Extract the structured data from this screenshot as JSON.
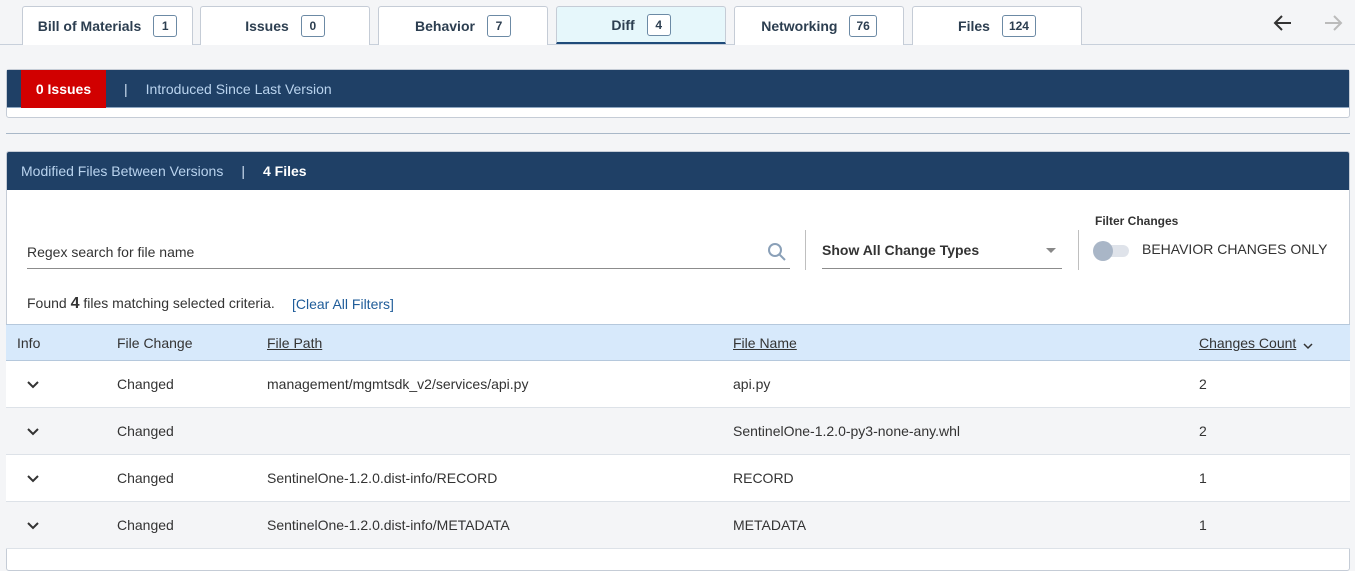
{
  "tabs": [
    {
      "label": "Bill of Materials",
      "count": "1"
    },
    {
      "label": "Issues",
      "count": "0"
    },
    {
      "label": "Behavior",
      "count": "7"
    },
    {
      "label": "Diff",
      "count": "4"
    },
    {
      "label": "Networking",
      "count": "76"
    },
    {
      "label": "Files",
      "count": "124"
    }
  ],
  "active_tab": "Diff",
  "nav": {
    "back_icon": "arrow-left-icon",
    "forward_icon": "arrow-right-icon"
  },
  "issues_bar": {
    "badge": "0 Issues",
    "separator": "|",
    "text": "Introduced Since Last Version"
  },
  "files_panel": {
    "title": "Modified Files Between Versions",
    "separator": "|",
    "file_count_label": "4 Files",
    "search": {
      "placeholder": "Regex search for file name",
      "value": ""
    },
    "change_type_select": {
      "value": "Show All Change Types"
    },
    "filter_changes_label": "Filter Changes",
    "toggle_label": "BEHAVIOR CHANGES ONLY",
    "toggle_on": false,
    "found_prefix": "Found",
    "found_count": "4",
    "found_suffix": "files matching selected criteria.",
    "clear_filters": "[Clear All Filters]"
  },
  "table": {
    "headers": {
      "info": "Info",
      "file_change": "File Change",
      "file_path": "File Path",
      "file_name": "File Name",
      "changes_count": "Changes Count"
    },
    "rows": [
      {
        "change": "Changed",
        "path": "management/mgmtsdk_v2/services/api.py",
        "name": "api.py",
        "count": "2"
      },
      {
        "change": "Changed",
        "path": "",
        "name": "SentinelOne-1.2.0-py3-none-any.whl",
        "count": "2"
      },
      {
        "change": "Changed",
        "path": "SentinelOne-1.2.0.dist-info/RECORD",
        "name": "RECORD",
        "count": "1"
      },
      {
        "change": "Changed",
        "path": "SentinelOne-1.2.0.dist-info/METADATA",
        "name": "METADATA",
        "count": "1"
      }
    ]
  },
  "colors": {
    "header_navy": "#1f4066",
    "issue_red": "#d10000",
    "table_header_bg": "#d7e9fb",
    "active_tab_bg": "#e6f7fb",
    "link_blue": "#1f5c99"
  }
}
